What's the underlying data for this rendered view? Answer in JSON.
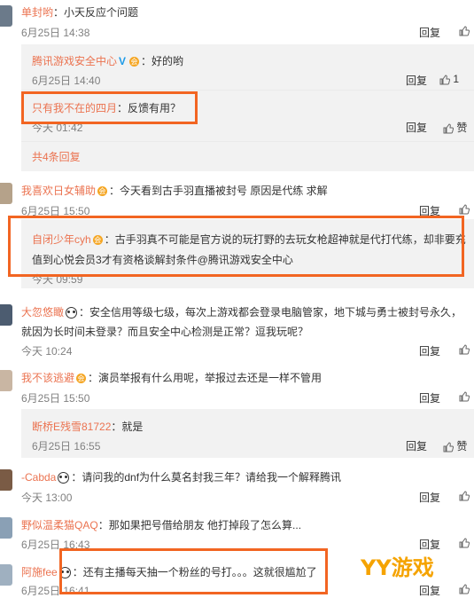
{
  "comments": [
    {
      "user": "单封哟",
      "text": "：小天反应个问题",
      "time": "6月25日 14:38"
    },
    {
      "user": "我喜欢日女辅助",
      "text": "：今天看到古手羽直播被封号 原因是代练 求解",
      "time": "6月25日 15:50"
    },
    {
      "user": "大忽悠瞰",
      "text_line1": "：安全信用等级七级，每次上游戏都会登录电脑管家，地下城与勇士被封号永久，",
      "text_line2": "就因为长时间未登录？而且安全中心检测是正常？逗我玩呢？",
      "time": "今天 10:24"
    },
    {
      "user": "我不该逃避",
      "text": "：演员举报有什么用呢，举报过去还是一样不管用",
      "time": "6月25日 15:50"
    },
    {
      "user": "-Cabda",
      "text": "：请问我的dnf为什么莫名封我三年？请给我一个解释腾讯",
      "time": "今天 13:00"
    },
    {
      "user": "野似温柔猫QAQ",
      "text": "：那如果把号借给朋友 他打掉段了怎么算...",
      "time": "6月25日 16:43"
    },
    {
      "user": "阿施fee",
      "text": "：还有主播每天抽一个粉丝的号打。。。这就很尴尬了",
      "time": "6月25日 16:41"
    }
  ],
  "replies": [
    {
      "user": "腾讯游戏安全中心",
      "verified": "V",
      "text": "：好的哟",
      "time": "6月25日 14:40",
      "likes": "1"
    },
    {
      "user": "只有我不在的四月",
      "text": "：反馈有用？",
      "time": "今天 01:42"
    },
    {
      "user": "自闭少年cyh",
      "text_line1": "：古手羽真不可能是官方说的玩打野的去玩女枪超神就是代打代练，却非要充",
      "text_line2": "值到心悦会员3才有资格谈解封条件@腾讯游戏安全中心",
      "time": "今天 09:59"
    },
    {
      "user": "断桥E残雪81722",
      "text": "：就是",
      "time": "6月25日 16:55"
    }
  ],
  "more_replies": "共4条回复",
  "reply_label": "回复",
  "like_label": "赞",
  "vip_badge": "会",
  "watermark": "YY游戏",
  "colors": {
    "name": "#eb7350",
    "highlight_box": "#f26522",
    "watermark": "#f5a300",
    "reply_bg": "#f2f2f2"
  }
}
